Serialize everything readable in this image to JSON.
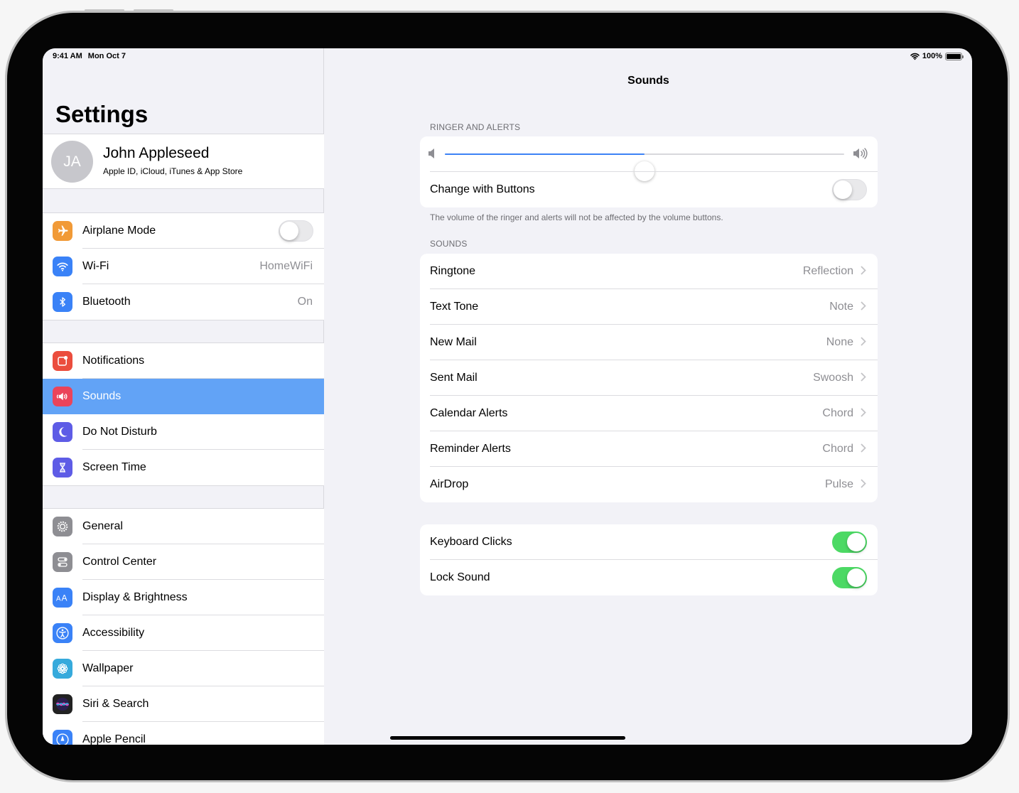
{
  "status_bar": {
    "time": "9:41 AM",
    "date": "Mon Oct 7",
    "battery": "100%"
  },
  "sidebar": {
    "title": "Settings",
    "profile": {
      "initials": "JA",
      "name": "John Appleseed",
      "subtitle": "Apple ID, iCloud, iTunes & App Store"
    },
    "group1": [
      {
        "label": "Airplane Mode",
        "icon": "airplane-icon",
        "color": "#f19a37",
        "toggle": false
      },
      {
        "label": "Wi-Fi",
        "icon": "wifi-icon",
        "color": "#3a82f7",
        "value": "HomeWiFi"
      },
      {
        "label": "Bluetooth",
        "icon": "bluetooth-icon",
        "color": "#3a82f7",
        "value": "On"
      }
    ],
    "group2": [
      {
        "label": "Notifications",
        "icon": "notifications-icon",
        "color": "#eb4d3d"
      },
      {
        "label": "Sounds",
        "icon": "speaker-icon",
        "color": "#eb445a",
        "selected": true
      },
      {
        "label": "Do Not Disturb",
        "icon": "moon-icon",
        "color": "#5e5ce6"
      },
      {
        "label": "Screen Time",
        "icon": "hourglass-icon",
        "color": "#5e5ce6"
      }
    ],
    "group3": [
      {
        "label": "General",
        "icon": "gear-icon",
        "color": "#8e8e93"
      },
      {
        "label": "Control Center",
        "icon": "switches-icon",
        "color": "#8e8e93"
      },
      {
        "label": "Display & Brightness",
        "icon": "text-size-icon",
        "color": "#3a82f7"
      },
      {
        "label": "Accessibility",
        "icon": "accessibility-icon",
        "color": "#3a82f7"
      },
      {
        "label": "Wallpaper",
        "icon": "flower-icon",
        "color": "#36aadc"
      },
      {
        "label": "Siri & Search",
        "icon": "siri-icon",
        "color": "#222222"
      },
      {
        "label": "Apple Pencil",
        "icon": "pencil-icon",
        "color": "#3a82f7"
      }
    ]
  },
  "detail": {
    "title": "Sounds",
    "ringer_header": "RINGER AND ALERTS",
    "ringer_volume": 0.5,
    "change_with_buttons": {
      "label": "Change with Buttons",
      "on": false
    },
    "ringer_footer": "The volume of the ringer and alerts will not be affected by the volume buttons.",
    "sounds_header": "SOUNDS",
    "sounds": [
      {
        "label": "Ringtone",
        "value": "Reflection"
      },
      {
        "label": "Text Tone",
        "value": "Note"
      },
      {
        "label": "New Mail",
        "value": "None"
      },
      {
        "label": "Sent Mail",
        "value": "Swoosh"
      },
      {
        "label": "Calendar Alerts",
        "value": "Chord"
      },
      {
        "label": "Reminder Alerts",
        "value": "Chord"
      },
      {
        "label": "AirDrop",
        "value": "Pulse"
      }
    ],
    "keyboard_clicks": {
      "label": "Keyboard Clicks",
      "on": true
    },
    "lock_sound": {
      "label": "Lock Sound",
      "on": true
    }
  },
  "colors": {
    "accent": "#3d82f6",
    "selected_row": "#62a3f6",
    "toggle_on": "#4cd964"
  }
}
